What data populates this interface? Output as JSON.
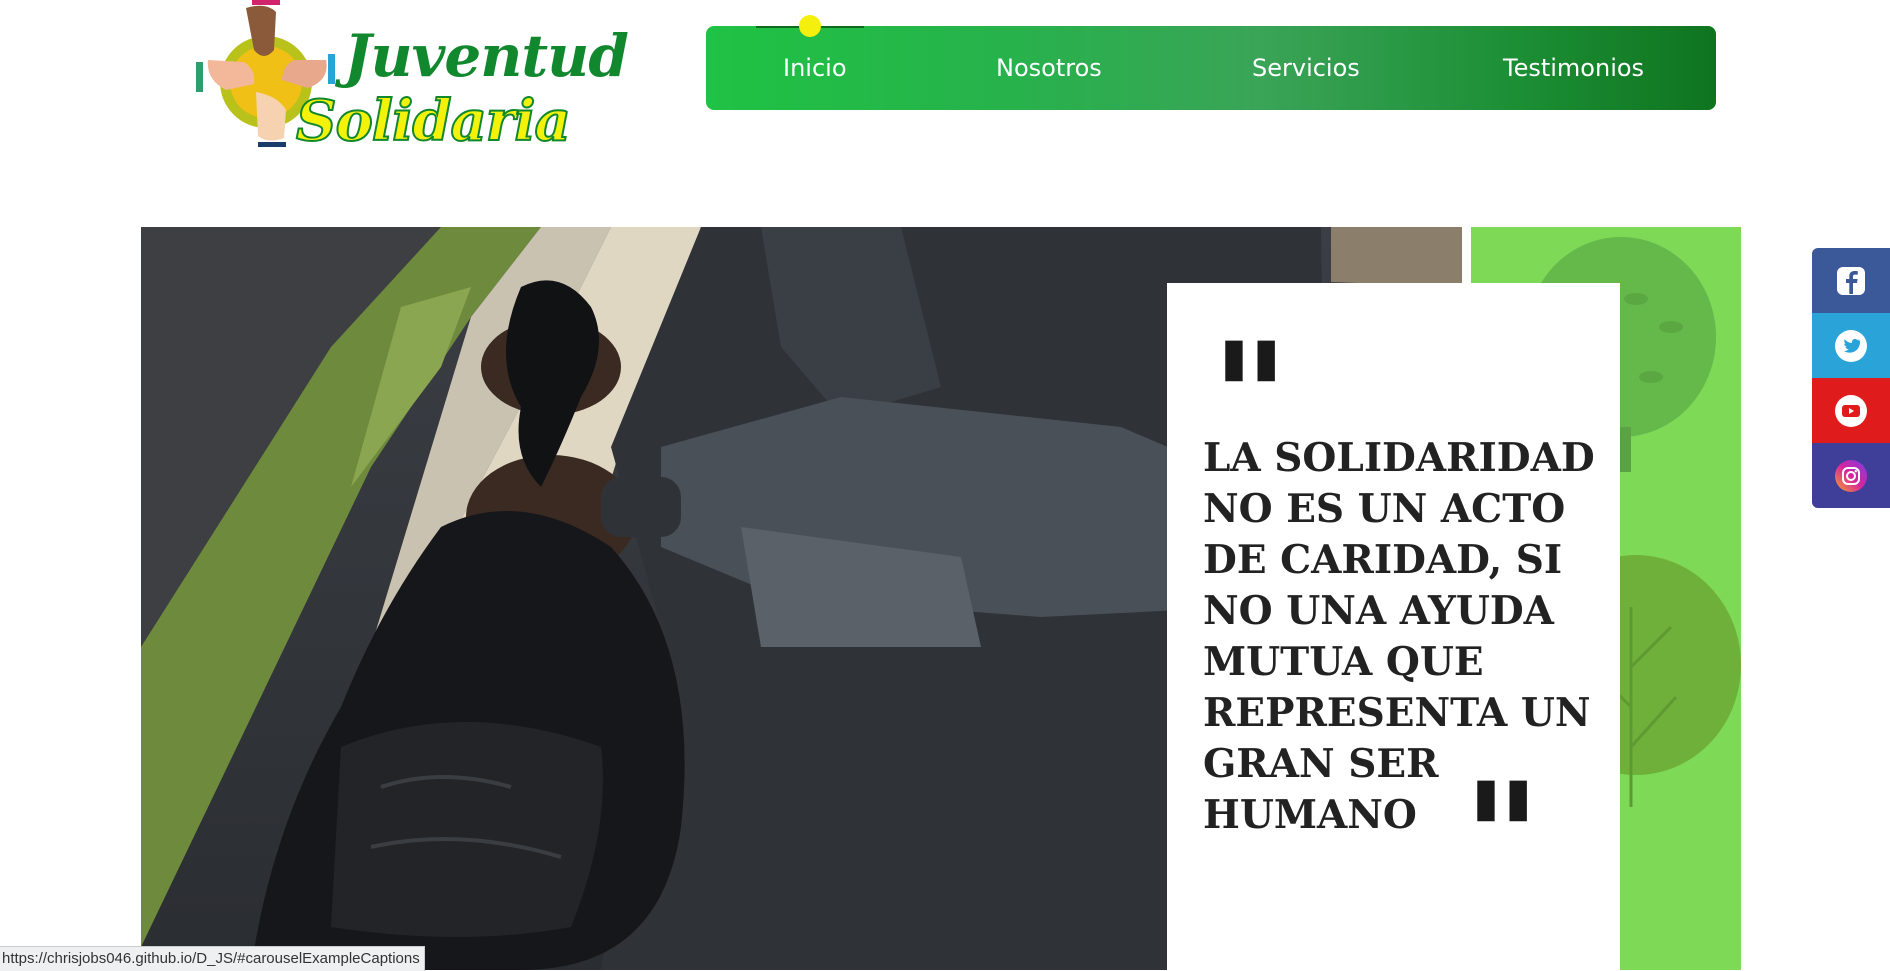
{
  "logo": {
    "word1": "Juventud",
    "word2": "Solidaria"
  },
  "nav": {
    "items": [
      {
        "label": "Inicio",
        "active": true
      },
      {
        "label": "Nosotros"
      },
      {
        "label": "Servicios"
      },
      {
        "label": "Testimonios"
      }
    ]
  },
  "hero": {
    "quote": "LA SOLIDARIDAD NO ES UN ACTO DE CARIDAD, SI NO UNA AYUDA MUTUA QUE REPRESENTA UN GRAN SER HUMANO",
    "quote_open": "\"",
    "quote_close": "\""
  },
  "social": [
    {
      "icon": "facebook-icon",
      "color": "#3b5998"
    },
    {
      "icon": "twitter-icon",
      "color": "#2aa3d9"
    },
    {
      "icon": "youtube-icon",
      "color": "#e01b1b"
    },
    {
      "icon": "instagram-icon",
      "color": "#3f3f9a"
    }
  ],
  "status_bar": {
    "url": "https://chrisjobs046.github.io/D_JS/#carouselExampleCaptions"
  },
  "colors": {
    "brand_green": "#12882e",
    "brand_yellow": "#f4f20a",
    "nav_start": "#1fc244",
    "nav_end": "#0f741f",
    "panel_green": "#7ed957"
  }
}
